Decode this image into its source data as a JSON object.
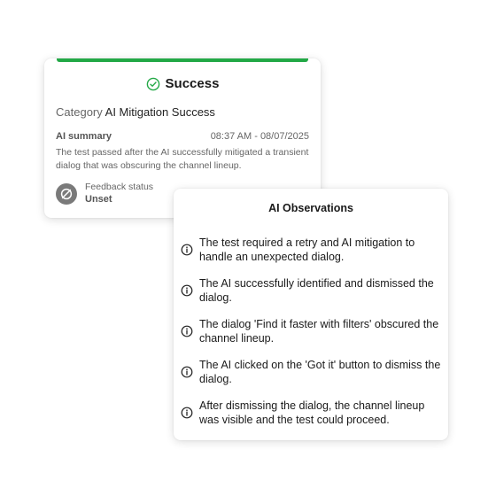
{
  "success_card": {
    "title": "Success",
    "category_label": "Category",
    "category_value": "AI Mitigation Success",
    "summary_label": "AI summary",
    "timestamp": "08:37 AM - 08/07/2025",
    "summary_text": "The test passed after the AI successfully mitigated a transient dialog that was obscuring the channel lineup.",
    "feedback_label": "Feedback status",
    "feedback_value": "Unset"
  },
  "observations_card": {
    "title": "AI Observations",
    "items": [
      "The test required a retry and AI mitigation to handle an unexpected dialog.",
      "The AI successfully identified and dismissed the dialog.",
      "The dialog 'Find it faster with filters' obscured the channel lineup.",
      "The AI clicked on the 'Got it' button to dismiss the dialog.",
      "After dismissing the dialog, the channel lineup was visible and the test could proceed."
    ]
  },
  "colors": {
    "success_green": "#22a846",
    "feedback_icon_gray": "#7a7a7a"
  },
  "icons": {
    "title": "check-circle-icon",
    "feedback": "slash-circle-icon",
    "observation": "info-icon"
  }
}
